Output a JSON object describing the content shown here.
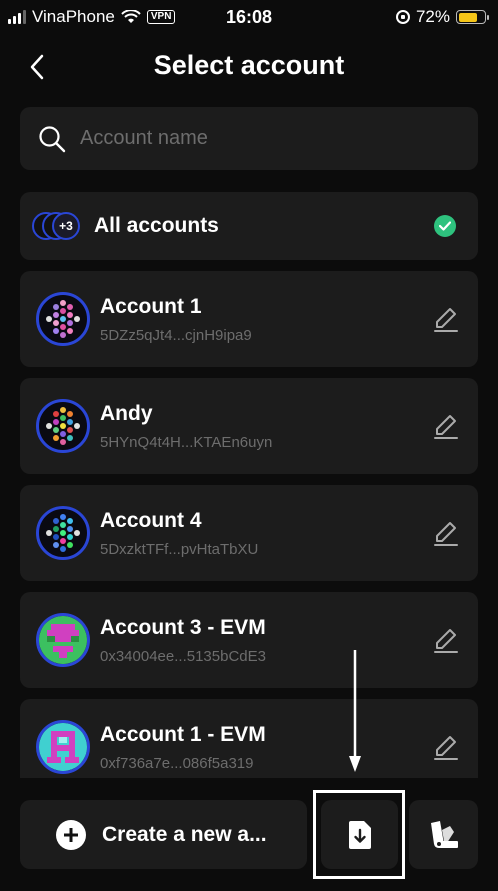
{
  "status_bar": {
    "carrier": "VinaPhone",
    "vpn": "VPN",
    "time": "16:08",
    "battery": "72%",
    "battery_level": 0.72,
    "battery_color": "#f5c518"
  },
  "header": {
    "title": "Select account",
    "back_icon": "chevron-left-icon"
  },
  "search": {
    "placeholder": "Account name",
    "value": "",
    "icon": "search-icon"
  },
  "all_accounts": {
    "label": "All accounts",
    "badge": "+3",
    "selected": true,
    "check_color": "#2ec27e"
  },
  "accounts": [
    {
      "name": "Account 1",
      "address": "5DZz5qJt4...cjnH9ipa9",
      "avatar": "polkadot-identicon-1"
    },
    {
      "name": "Andy",
      "address": "5HYnQ4t4H...KTAEn6uyn",
      "avatar": "polkadot-identicon-2"
    },
    {
      "name": "Account 4",
      "address": "5DxzktTFf...pvHtaTbXU",
      "avatar": "polkadot-identicon-3"
    },
    {
      "name": "Account 3 - EVM",
      "address": "0x34004ee...5135bCdE3",
      "avatar": "evm-pixel-avatar-1"
    },
    {
      "name": "Account 1 - EVM",
      "address": "0xf736a7e...086f5a319",
      "avatar": "evm-pixel-avatar-2"
    }
  ],
  "bottom": {
    "create_label": "Create a new a...",
    "import_icon": "import-file-icon",
    "attach_icon": "attach-account-icon"
  },
  "colors": {
    "background": "#0c0c0c",
    "card": "#1c1c1c",
    "avatar_ring": "#2a46d6",
    "muted_text": "#6d6d6d"
  }
}
